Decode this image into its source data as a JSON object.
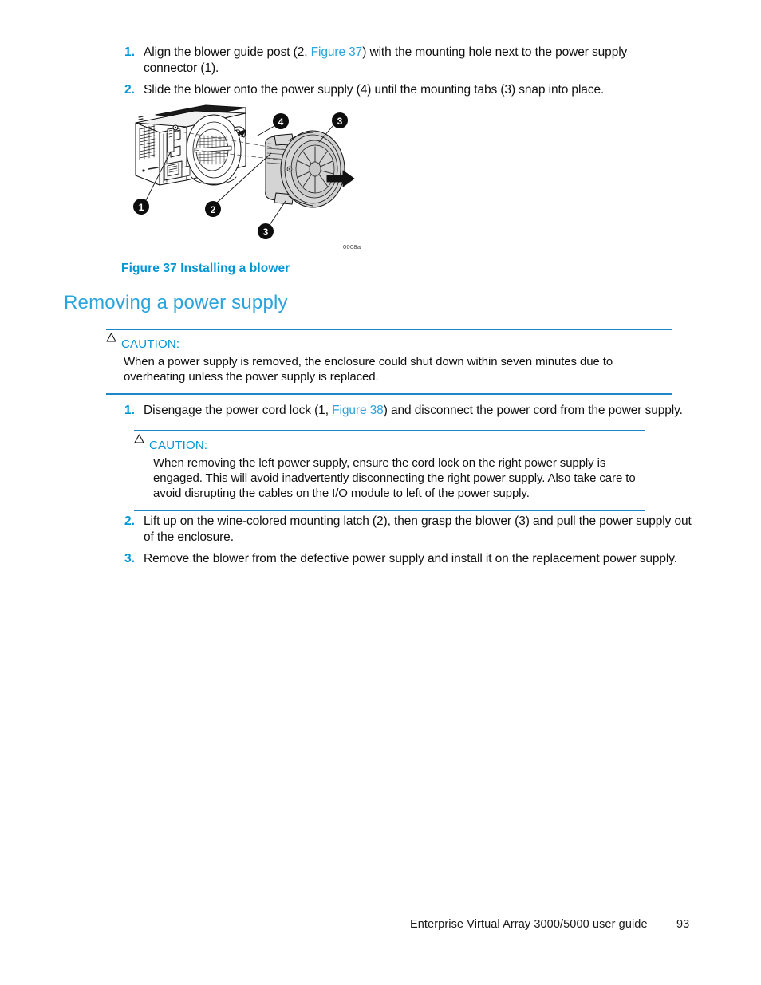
{
  "document": {
    "title": "Enterprise Virtual Array 3000/5000 user guide",
    "page_number": "93",
    "accent_color": "#0096d6",
    "link_color": "#2aa4dd",
    "body_color": "#101010"
  },
  "top_steps": [
    {
      "num": "1.",
      "pre": "Align the blower guide post (2, ",
      "link": "Figure 37",
      "post": ") with the mounting hole next to the power supply connector (1)."
    },
    {
      "num": "2.",
      "pre": "Slide the blower onto the power supply (4) until the mounting tabs (3) snap into place.",
      "link": "",
      "post": ""
    }
  ],
  "figure": {
    "id_label": "0008a",
    "caption": "Figure 37 Installing a blower",
    "callouts": [
      {
        "label": "1"
      },
      {
        "label": "2"
      },
      {
        "label": "3"
      },
      {
        "label": "3"
      },
      {
        "label": "4"
      }
    ]
  },
  "heading": {
    "text": "Removing a power supply"
  },
  "caution_1": {
    "icon": "warning-triangle-icon",
    "title": "CAUTION:",
    "body": "When a power supply is removed, the enclosure could shut down within seven minutes due to overheating unless the power supply is replaced."
  },
  "step_cord": {
    "num": "1.",
    "pre": "Disengage the power cord lock (1, ",
    "link": "Figure 38",
    "post": ") and disconnect the power cord from the power supply."
  },
  "caution_2": {
    "icon": "warning-triangle-icon",
    "title": "CAUTION:",
    "body": "When removing the left power supply, ensure the cord lock on the right power supply is engaged. This will avoid inadvertently disconnecting the right power supply. Also take care to avoid disrupting the cables on the I/O module to left of the power supply."
  },
  "bottom_steps": [
    {
      "num": "2.",
      "pre": "Lift up on the wine-colored mounting latch (2), then grasp the blower (3) and pull the power supply out of the enclosure.",
      "link": "",
      "post": ""
    },
    {
      "num": "3.",
      "pre": "Remove the blower from the defective power supply and install it on the replacement power supply.",
      "link": "",
      "post": ""
    }
  ]
}
